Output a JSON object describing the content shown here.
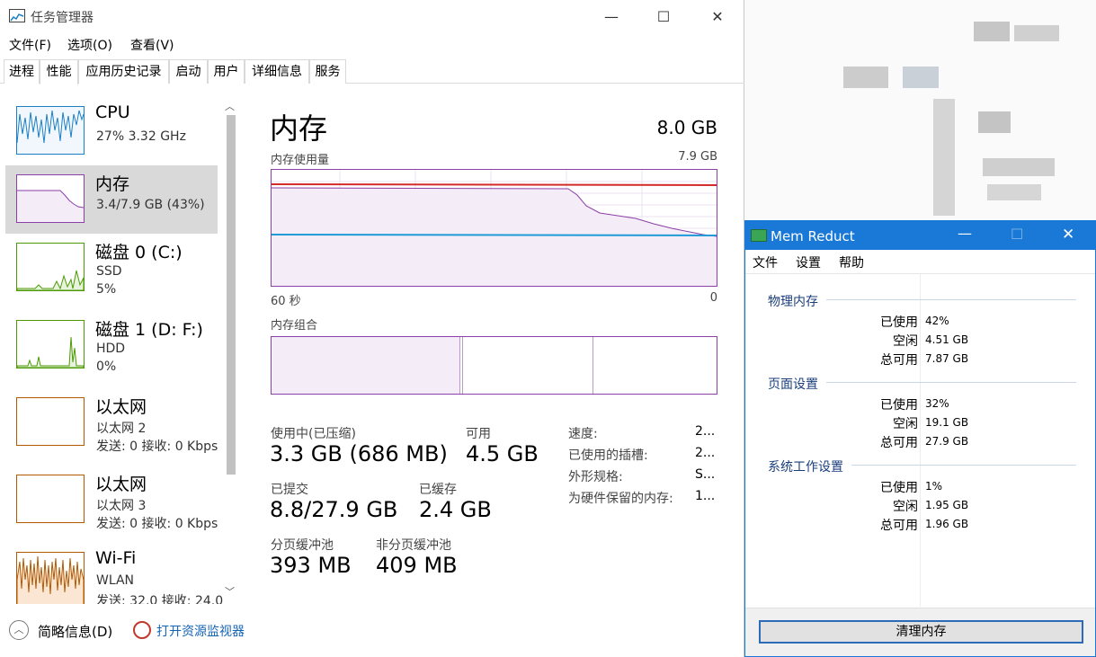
{
  "taskmanager": {
    "title": "任务管理器",
    "menu": [
      "文件(F)",
      "选项(O)",
      "查看(V)"
    ],
    "tabs": [
      "进程",
      "性能",
      "应用历史记录",
      "启动",
      "用户",
      "详细信息",
      "服务"
    ],
    "active_tab": "性能",
    "sidebar": [
      {
        "name": "CPU",
        "line1": "27%  3.32 GHz",
        "line2": "",
        "color": "#1b7fc4"
      },
      {
        "name": "内存",
        "line1": "3.4/7.9 GB (43%)",
        "line2": "",
        "color": "#8b3fa8"
      },
      {
        "name": "磁盘 0 (C:)",
        "line1": "SSD",
        "line2": "5%",
        "color": "#4e9a06"
      },
      {
        "name": "磁盘 1 (D: F:)",
        "line1": "HDD",
        "line2": "0%",
        "color": "#4e9a06"
      },
      {
        "name": "以太网",
        "line1": "以太网 2",
        "line2": "发送: 0 接收: 0 Kbps",
        "color": "#b35900"
      },
      {
        "name": "以太网",
        "line1": "以太网 3",
        "line2": "发送: 0 接收: 0 Kbps",
        "color": "#b35900"
      },
      {
        "name": "Wi-Fi",
        "line1": "WLAN",
        "line2": "发送: 32.0 接收: 24.0",
        "color": "#b35900"
      }
    ],
    "detail": {
      "title": "内存",
      "total": "8.0 GB",
      "usage_label": "内存使用量",
      "usage_max": "7.9 GB",
      "time_left": "60 秒",
      "time_right": "0",
      "composition_label": "内存组合",
      "stats": {
        "in_use_label": "使用中(已压缩)",
        "in_use": "3.3 GB (686 MB)",
        "available_label": "可用",
        "available": "4.5 GB",
        "committed_label": "已提交",
        "committed": "8.8/27.9 GB",
        "cached_label": "已缓存",
        "cached": "2.4 GB",
        "paged_label": "分页缓冲池",
        "paged": "393 MB",
        "nonpaged_label": "非分页缓冲池",
        "nonpaged": "409 MB"
      },
      "side": [
        {
          "k": "速度:",
          "v": "2..."
        },
        {
          "k": "已使用的插槽:",
          "v": "2..."
        },
        {
          "k": "外形规格:",
          "v": "S..."
        },
        {
          "k": "为硬件保留的内存:",
          "v": "1..."
        }
      ]
    },
    "footer": {
      "summary": "简略信息(D)",
      "monitor": "打开资源监视器"
    }
  },
  "memreduct": {
    "title": "Mem Reduct",
    "menu": [
      "文件",
      "设置",
      "帮助"
    ],
    "sections": [
      {
        "title": "物理内存",
        "rows": [
          {
            "k": "已使用",
            "v": "42%"
          },
          {
            "k": "空闲",
            "v": "4.51 GB"
          },
          {
            "k": "总可用",
            "v": "7.87 GB"
          }
        ]
      },
      {
        "title": "页面设置",
        "rows": [
          {
            "k": "已使用",
            "v": "32%"
          },
          {
            "k": "空闲",
            "v": "19.1 GB"
          },
          {
            "k": "总可用",
            "v": "27.9 GB"
          }
        ]
      },
      {
        "title": "系统工作设置",
        "rows": [
          {
            "k": "已使用",
            "v": "1%"
          },
          {
            "k": "空闲",
            "v": "1.95 GB"
          },
          {
            "k": "总可用",
            "v": "1.96 GB"
          }
        ]
      }
    ],
    "clean_button": "清理内存"
  },
  "colors": {
    "mem_purple": "#8b3fa8",
    "mem_fill": "#f4edf7",
    "red_line": "#d42a2a",
    "blue_line": "#1e9bd7",
    "mr_blue": "#1a79d6"
  }
}
